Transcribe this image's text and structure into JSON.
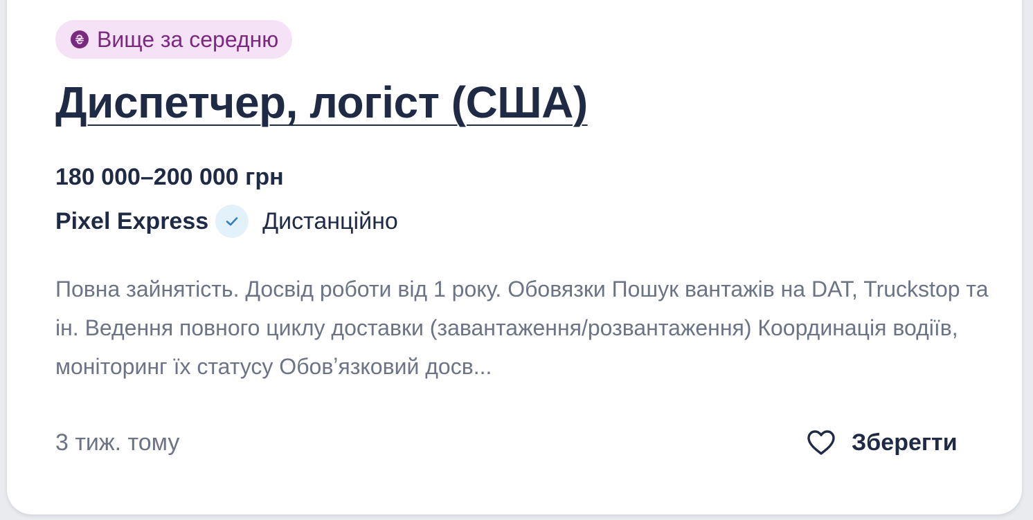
{
  "badge": {
    "label": "Вище за середню",
    "icon": "hryvnia-coin-icon",
    "color": "#7a2a7e",
    "background": "#f6e2f6"
  },
  "job": {
    "title": "Диспетчер, логіст (США)",
    "salary": "180 000–200 000 грн",
    "company": "Pixel Express",
    "company_verified": true,
    "location": "Дистанційно",
    "description": "Повна зайнятість. Досвід роботи від 1 року. Обовязки Пошук вантажів на DAT, Truckstop та ін. Ведення повного циклу доставки (завантаження/розвантаження) Координація водіїв, моніторинг їх статусу Обовʼязковий досв...",
    "posted": "3 тиж. тому"
  },
  "actions": {
    "save_label": "Зберегти",
    "save_icon": "heart-outline-icon"
  },
  "colors": {
    "text_primary": "#1f2a44",
    "text_secondary": "#6b7385",
    "verified_bg": "#e3f1fb",
    "verified_check": "#2f7fc1"
  }
}
